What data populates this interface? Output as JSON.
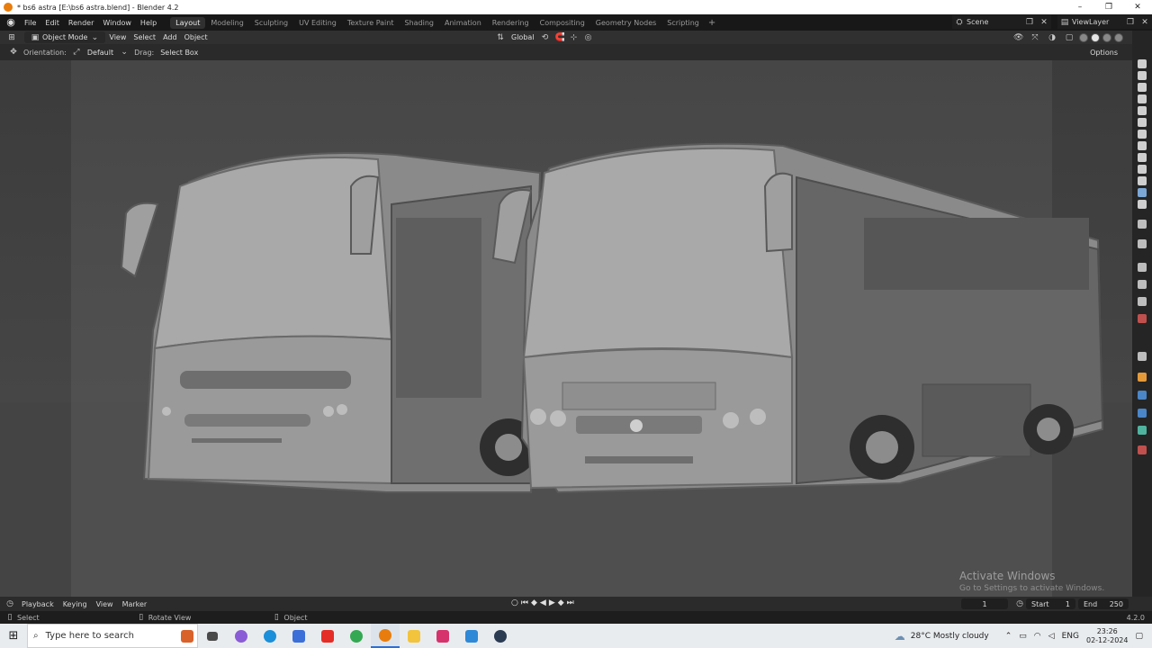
{
  "window": {
    "title": "* bs6 astra [E:\\bs6 astra.blend] - Blender 4.2",
    "minimize": "–",
    "maximize": "❐",
    "close": "✕"
  },
  "menubar": {
    "items": [
      "File",
      "Edit",
      "Render",
      "Window",
      "Help"
    ],
    "workspaces": [
      "Layout",
      "Modeling",
      "Sculpting",
      "UV Editing",
      "Texture Paint",
      "Shading",
      "Animation",
      "Rendering",
      "Compositing",
      "Geometry Nodes",
      "Scripting"
    ],
    "active_workspace": "Layout",
    "add": "+",
    "scene": "Scene",
    "view_layer": "ViewLayer"
  },
  "header": {
    "mode": "Object Mode",
    "menus": [
      "View",
      "Select",
      "Add",
      "Object"
    ],
    "orientation_global": "Global"
  },
  "tool_settings": {
    "orientation_label": "Orientation:",
    "orientation_value": "Default",
    "drag_label": "Drag:",
    "drag_value": "Select Box",
    "options": "Options"
  },
  "viewport": {
    "watermark_title": "Activate Windows",
    "watermark_sub": "Go to Settings to activate Windows."
  },
  "timeline": {
    "playback": "Playback",
    "keying": "Keying",
    "view": "View",
    "marker": "Marker",
    "current_frame": "1",
    "start_label": "Start",
    "start_value": "1",
    "end_label": "End",
    "end_value": "250"
  },
  "statusbar": {
    "select": "Select",
    "rotate_view": "Rotate View",
    "object": "Object",
    "version": "4.2.0"
  },
  "taskbar": {
    "search_placeholder": "Type here to search",
    "weather": "28°C  Mostly cloudy",
    "language": "ENG",
    "time": "23:26",
    "date": "02-12-2024"
  },
  "colors": {
    "blender_orange": "#e87d0d",
    "viewport_bg": "#3c3c3c",
    "header_bg": "#303030"
  }
}
